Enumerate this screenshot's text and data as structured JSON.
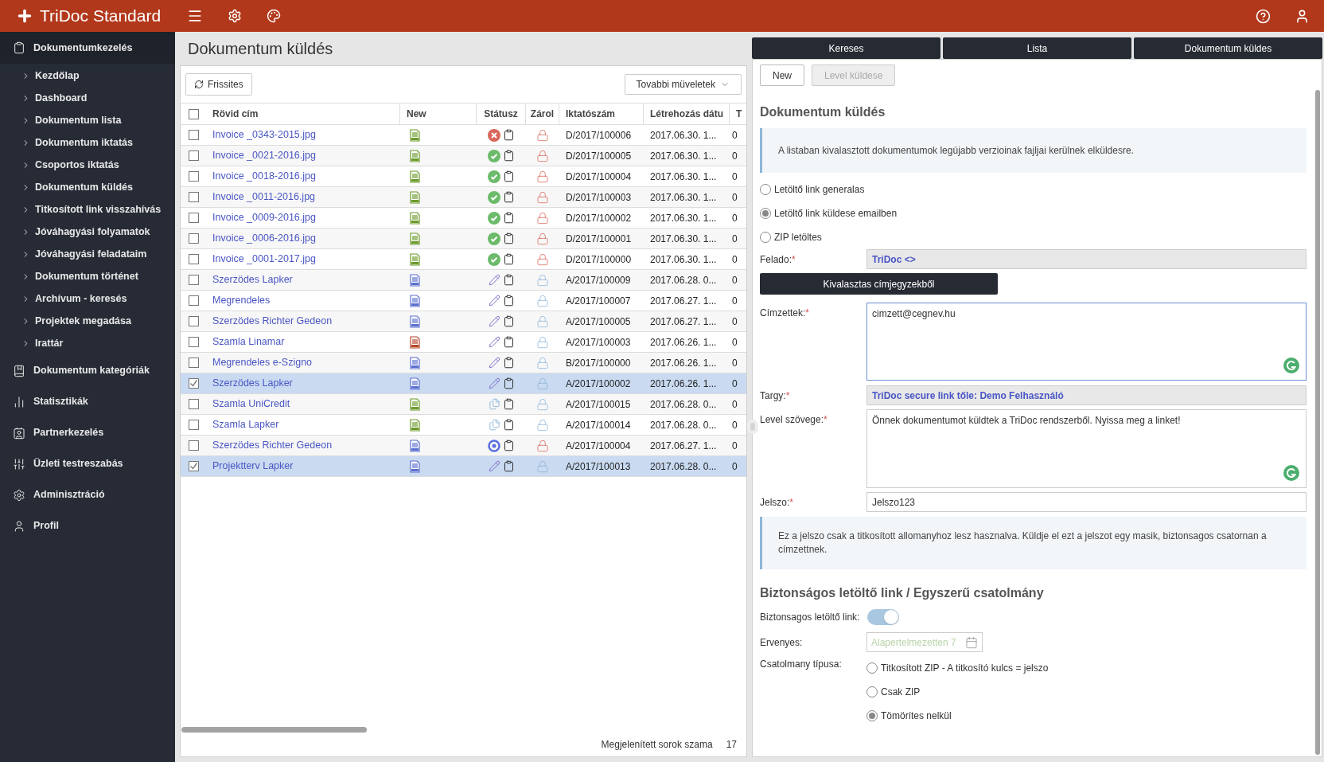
{
  "app": {
    "title": "TriDoc Standard"
  },
  "sidebar": [
    {
      "label": "Dokumentumkezelés",
      "expanded": true,
      "children": [
        {
          "label": "Kezdőlap"
        },
        {
          "label": "Dashboard"
        },
        {
          "label": "Dokumentum lista"
        },
        {
          "label": "Dokumentum iktatás"
        },
        {
          "label": "Csoportos iktatás"
        },
        {
          "label": "Dokumentum küldés"
        },
        {
          "label": "Titkosított link visszahívás"
        },
        {
          "label": "Jóváhagyási folyamatok"
        },
        {
          "label": "Jóváhagyási feladataim"
        },
        {
          "label": "Dokumentum történet"
        },
        {
          "label": "Archívum - keresés"
        },
        {
          "label": "Projektek megadása"
        },
        {
          "label": "Irattár"
        }
      ]
    },
    {
      "label": "Dokumentum kategóriák",
      "expanded": false
    },
    {
      "label": "Statisztikák",
      "expanded": false
    },
    {
      "label": "Partnerkezelés",
      "expanded": false
    },
    {
      "label": "Üzleti testreszabás",
      "expanded": false
    },
    {
      "label": "Adminisztráció",
      "expanded": false
    },
    {
      "label": "Profil",
      "expanded": false
    }
  ],
  "page": {
    "title": "Dokumentum küldés"
  },
  "toolbar": {
    "refresh": "Frissites",
    "more": "Tovabbi müveletek"
  },
  "table": {
    "all_selected": false,
    "columns": [
      "Rövid cím",
      "New",
      "Státusz",
      "Zárol",
      "Iktatószám",
      "Létrehozás dátu",
      "T"
    ],
    "rows": [
      {
        "selected": false,
        "title": "Invoice _0343-2015.jpg",
        "file": {
          "kind": "jpg"
        },
        "status": {
          "kind": "error"
        },
        "locked": true,
        "number": "D/2017/100006",
        "created": "2017.06.30. 1...",
        "column_7": "0"
      },
      {
        "selected": false,
        "title": "Invoice _0021-2016.jpg",
        "file": {
          "kind": "jpg"
        },
        "status": {
          "kind": "ok"
        },
        "locked": true,
        "number": "D/2017/100005",
        "created": "2017.06.30. 1...",
        "column_7": "0"
      },
      {
        "selected": false,
        "title": "Invoice _0018-2016.jpg",
        "file": {
          "kind": "jpg"
        },
        "status": {
          "kind": "ok"
        },
        "locked": true,
        "number": "D/2017/100004",
        "created": "2017.06.30. 1...",
        "column_7": "0"
      },
      {
        "selected": false,
        "title": "Invoice _0011-2016.jpg",
        "file": {
          "kind": "jpg"
        },
        "status": {
          "kind": "ok"
        },
        "locked": true,
        "number": "D/2017/100003",
        "created": "2017.06.30. 1...",
        "column_7": "0"
      },
      {
        "selected": false,
        "title": "Invoice _0009-2016.jpg",
        "file": {
          "kind": "jpg"
        },
        "status": {
          "kind": "ok"
        },
        "locked": true,
        "number": "D/2017/100002",
        "created": "2017.06.30. 1...",
        "column_7": "0"
      },
      {
        "selected": false,
        "title": "Invoice _0006-2016.jpg",
        "file": {
          "kind": "jpg"
        },
        "status": {
          "kind": "ok"
        },
        "locked": true,
        "number": "D/2017/100001",
        "created": "2017.06.30. 1...",
        "column_7": "0"
      },
      {
        "selected": false,
        "title": "Invoice _0001-2017.jpg",
        "file": {
          "kind": "jpg"
        },
        "status": {
          "kind": "ok"
        },
        "locked": true,
        "number": "D/2017/100000",
        "created": "2017.06.30. 1...",
        "column_7": "0"
      },
      {
        "selected": false,
        "title": "Szerzödes Lapker",
        "file": {
          "kind": "docx"
        },
        "status": {
          "kind": "edit"
        },
        "locked": false,
        "number": "A/2017/100009",
        "created": "2017.06.28. 0...",
        "column_7": "0"
      },
      {
        "selected": false,
        "title": "Megrendeles",
        "file": {
          "kind": "docx"
        },
        "status": {
          "kind": "edit"
        },
        "locked": false,
        "number": "A/2017/100007",
        "created": "2017.06.27. 1...",
        "column_7": "0"
      },
      {
        "selected": false,
        "title": "Szerzödes Richter Gedeon",
        "file": {
          "kind": "docx"
        },
        "status": {
          "kind": "edit"
        },
        "locked": false,
        "number": "A/2017/100005",
        "created": "2017.06.27. 1...",
        "column_7": "0"
      },
      {
        "selected": false,
        "title": "Szamla Linamar",
        "file": {
          "kind": "pdf"
        },
        "status": {
          "kind": "edit"
        },
        "locked": false,
        "number": "A/2017/100003",
        "created": "2017.06.26. 1...",
        "column_7": "0"
      },
      {
        "selected": false,
        "title": "Megrendeles e-Szigno",
        "file": {
          "kind": "docx"
        },
        "status": {
          "kind": "edit"
        },
        "locked": false,
        "number": "B/2017/100000",
        "created": "2017.06.26. 1...",
        "column_7": "0"
      },
      {
        "selected": true,
        "title": "Szerzödes Lapker",
        "file": {
          "kind": "docx"
        },
        "status": {
          "kind": "edit"
        },
        "locked": false,
        "number": "A/2017/100002",
        "created": "2017.06.26. 1...",
        "column_7": "0"
      },
      {
        "selected": false,
        "title": "Szamla UniCredit",
        "file": {
          "kind": "jpg"
        },
        "status": {
          "kind": "copy"
        },
        "locked": false,
        "number": "A/2017/100015",
        "created": "2017.06.28. 0...",
        "column_7": "0"
      },
      {
        "selected": false,
        "title": "Szamla Lapker",
        "file": {
          "kind": "jpg"
        },
        "status": {
          "kind": "copy"
        },
        "locked": false,
        "number": "A/2017/100014",
        "created": "2017.06.28. 0...",
        "column_7": "0"
      },
      {
        "selected": false,
        "title": "Szerzödes Richter Gedeon",
        "file": {
          "kind": "docx"
        },
        "status": {
          "kind": "target"
        },
        "locked": true,
        "number": "A/2017/100004",
        "created": "2017.06.27. 1...",
        "column_7": "0"
      },
      {
        "selected": true,
        "title": "Projektterv Lapker",
        "file": {
          "kind": "docx"
        },
        "status": {
          "kind": "edit"
        },
        "locked": false,
        "number": "A/2017/100013",
        "created": "2017.06.28. 0...",
        "column_7": "0"
      }
    ]
  },
  "footer": {
    "label": "Megjelenített sorok szama",
    "value": "17"
  },
  "tabs": [
    {
      "label": "Kereses"
    },
    {
      "label": "Lista"
    },
    {
      "label": "Dokumentum küldes"
    }
  ],
  "actions": [
    {
      "label": "New",
      "disabled": false
    },
    {
      "label": "Level küldese",
      "disabled": true
    }
  ],
  "form": {
    "heading": "Dokumentum küldés",
    "info": "A listaban kivalasztott dokumentumok legújabb verzioinak fajljai kerülnek elküldesre.",
    "modes": [
      {
        "label": "Letöltő link generalas",
        "selected": false
      },
      {
        "label": "Letöltő link küldese emailben",
        "selected": true
      },
      {
        "label": "ZIP letöltes",
        "selected": false
      }
    ],
    "sender": {
      "label": "Felado:",
      "mark": "*",
      "value": "TriDoc <>"
    },
    "pick_button": "Kivalasztas címjegyzekből",
    "recipients": {
      "label": "Címzettek:",
      "mark": "*",
      "value": "cimzett@cegnev.hu"
    },
    "subject": {
      "label": "Targy:",
      "mark": "*",
      "value": "TriDoc secure link tőle: Demo Felhasználó"
    },
    "body": {
      "label": "Level szövege:",
      "mark": "*",
      "value": "Önnek dokumentumot küldtek a TriDoc rendszerből. Nyissa meg a linket!"
    },
    "password": {
      "label": "Jelszo:",
      "mark": "*",
      "value": "Jelszo123"
    },
    "password_info": "Ez a jelszo csak a titkosított allomanyhoz lesz hasznalva. Küldje el ezt a jelszot egy masik, biztonsagos csatornan a címzettnek.",
    "section_heading": "Biztonságos letöltő link / Egyszerű csatolmány",
    "secure_link": {
      "label": "Biztonsagos letöltő link:",
      "on": true
    },
    "valid": {
      "label": "Ervenyes:",
      "placeholder": "Alapertelmezetten 7"
    },
    "attachment": {
      "label": "Csatolmany típusa:",
      "options": [
        {
          "label": "Titkosított ZIP - A titkosító kulcs = jelszo",
          "selected": false
        },
        {
          "label": "Csak ZIP",
          "selected": false
        },
        {
          "label": "Tömörítes nelkül",
          "selected": true
        }
      ]
    }
  }
}
